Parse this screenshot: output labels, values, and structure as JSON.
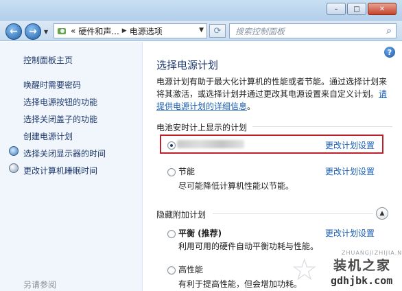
{
  "window": {
    "address": {
      "parent": "硬件和声...",
      "current": "电源选项",
      "prefix": "«"
    },
    "search_placeholder": "搜索控制面板",
    "controls": {
      "minimize": "–",
      "maximize": "□",
      "close": "✕"
    }
  },
  "sidebar": {
    "items": [
      {
        "label": "控制面板主页"
      },
      {
        "label": "唤醒时需要密码"
      },
      {
        "label": "选择电源按钮的功能"
      },
      {
        "label": "选择关闭盖子的功能"
      },
      {
        "label": "创建电源计划"
      },
      {
        "label": "选择关闭显示器的时间",
        "icon": "display-clock-icon"
      },
      {
        "label": "更改计算机睡眠时间",
        "icon": "moon-icon"
      }
    ],
    "footer": "另请参阅"
  },
  "main": {
    "help": "?",
    "title": "选择电源计划",
    "description": "电源计划有助于最大化计算机的性能或者节能。通过选择计划来将其激活，或选择计划并通过更改其电源设置来自定义计划。",
    "description_link": "请提供电源计划的详细信息",
    "description_end": "。",
    "battery_section": "电池安时计上显示的计划",
    "hidden_section": "隐藏附加计划",
    "plans": [
      {
        "name": "",
        "desc": "",
        "change": "更改计划设置",
        "selected": true
      },
      {
        "name": "节能",
        "desc": "尽可能降低计算机性能以节能。",
        "change": "更改计划设置",
        "selected": false
      },
      {
        "name": "平衡 (推荐)",
        "desc": "利用可用的硬件自动平衡功耗与性能。",
        "change": "更改计划设置",
        "selected": false
      },
      {
        "name": "高性能",
        "desc": "有利于提高性能，但会增加功耗。",
        "change": "",
        "selected": false
      }
    ]
  },
  "watermark": {
    "small": "ZHUANGJIZHIJIA.NET",
    "big": "装机之家",
    "url": "gdhjbk.com"
  },
  "colors": {
    "link": "#1a5fb4",
    "highlight": "#c0202a",
    "sidebar_bg": "#f1f6fc"
  }
}
